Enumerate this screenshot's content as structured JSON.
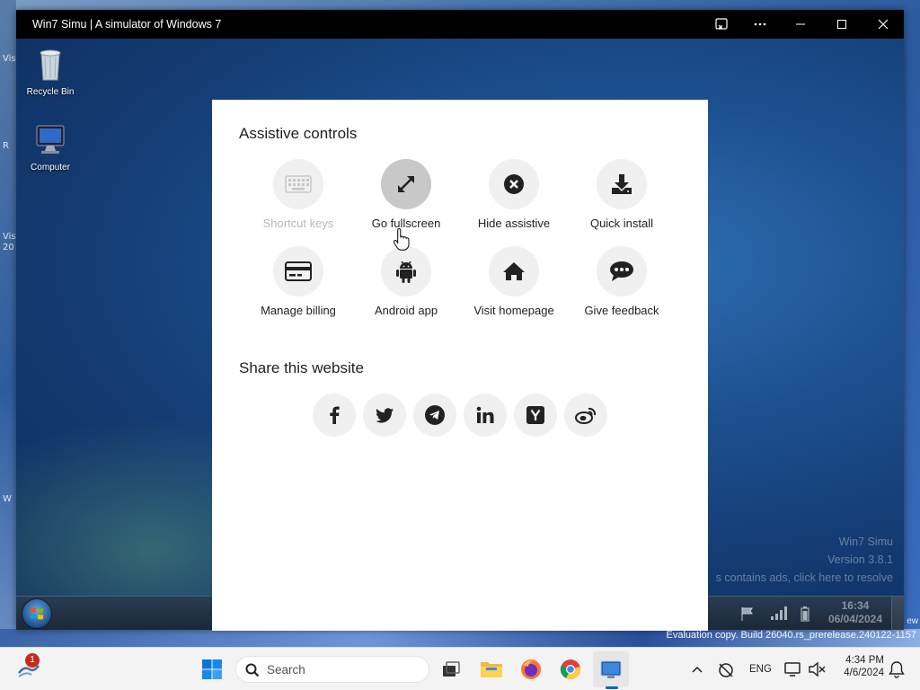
{
  "window": {
    "title": "Win7 Simu | A simulator of Windows 7",
    "buttons": [
      "cast-icon",
      "more-icon",
      "minimize-icon",
      "maximize-icon",
      "close-icon"
    ]
  },
  "host_left_texts": [
    "Vis",
    "R",
    "Vis",
    "20",
    "W"
  ],
  "host_right_text": "ew",
  "win7_desktop": {
    "icons": [
      {
        "label": "Recycle Bin",
        "icon": "recycle-bin-icon"
      },
      {
        "label": "Computer",
        "icon": "computer-icon"
      }
    ],
    "watermark": {
      "name": "Win7 Simu",
      "version": "Version 3.8.1",
      "ads": "s contains ads, click here to resolve"
    },
    "taskbar": {
      "clock_time": "16:34",
      "clock_date": "06/04/2024",
      "tray_icons": [
        "flag-icon",
        "signal-icon",
        "battery-icon"
      ]
    }
  },
  "dialog": {
    "assistive_title": "Assistive controls",
    "controls": [
      {
        "label": "Shortcut keys",
        "icon": "keyboard-icon",
        "disabled": true
      },
      {
        "label": "Go fullscreen",
        "icon": "fullscreen-icon",
        "active": true
      },
      {
        "label": "Hide assistive",
        "icon": "close-circle-icon"
      },
      {
        "label": "Quick install",
        "icon": "download-icon"
      },
      {
        "label": "Manage billing",
        "icon": "credit-card-icon"
      },
      {
        "label": "Android app",
        "icon": "android-icon"
      },
      {
        "label": "Visit homepage",
        "icon": "home-icon"
      },
      {
        "label": "Give feedback",
        "icon": "chat-icon"
      }
    ],
    "share_title": "Share this website",
    "share_buttons": [
      "facebook-icon",
      "twitter-icon",
      "telegram-icon",
      "linkedin-icon",
      "ycombinator-icon",
      "weibo-icon"
    ]
  },
  "eval_text": "Evaluation copy. Build 26040.rs_prerelease.240122-1157",
  "w11_taskbar": {
    "notification_count": "1",
    "search_placeholder": "Search",
    "lang": "ENG",
    "time": "4:34 PM",
    "date": "4/6/2024"
  },
  "colors": {
    "titlebar": "#000000",
    "dialog_bg": "#ffffff",
    "circle_bg": "#f0f0f0",
    "circle_active": "#c8c8c8",
    "badge": "#c42b1c"
  }
}
